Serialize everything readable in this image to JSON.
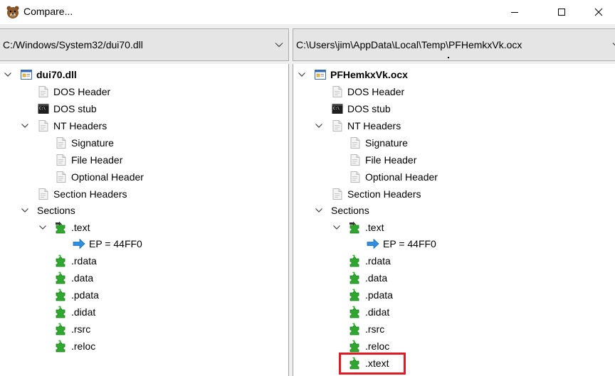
{
  "window": {
    "title": "Compare..."
  },
  "left": {
    "path": "C:/Windows/System32/dui70.dll",
    "root": "dui70.dll",
    "items": {
      "dos_header": "DOS Header",
      "dos_stub": "DOS stub",
      "nt_headers": "NT Headers",
      "signature": "Signature",
      "file_header": "File Header",
      "optional_header": "Optional Header",
      "section_headers": "Section Headers",
      "sections": "Sections",
      "text": ".text",
      "ep": "EP = 44FF0",
      "rdata": ".rdata",
      "data": ".data",
      "pdata": ".pdata",
      "didat": ".didat",
      "rsrc": ".rsrc",
      "reloc": ".reloc"
    }
  },
  "right": {
    "path": "C:\\Users\\jim\\AppData\\Local\\Temp\\PFHemkxVk.ocx",
    "root": "PFHemkxVk.ocx",
    "items": {
      "dos_header": "DOS Header",
      "dos_stub": "DOS stub",
      "nt_headers": "NT Headers",
      "signature": "Signature",
      "file_header": "File Header",
      "optional_header": "Optional Header",
      "section_headers": "Section Headers",
      "sections": "Sections",
      "text": ".text",
      "ep": "EP = 44FF0",
      "rdata": ".rdata",
      "data": ".data",
      "pdata": ".pdata",
      "didat": ".didat",
      "rsrc": ".rsrc",
      "reloc": ".reloc",
      "xtext": ".xtext"
    }
  },
  "icons": {
    "file": "page-icon",
    "stub": "console-icon",
    "section": "puzzle-piece-icon",
    "entry": "arrow-right-icon",
    "module": "module-window-icon"
  },
  "colors": {
    "highlight": "#e01b24",
    "puzzle_green": "#2fa82f",
    "arrow_blue": "#2e8fe0"
  }
}
